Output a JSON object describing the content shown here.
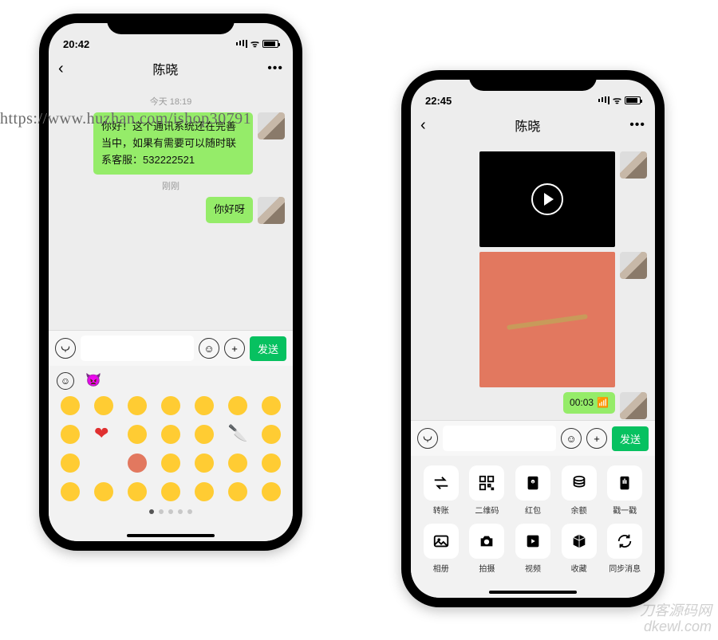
{
  "watermark_url": "https://www.huzhan.com/ishop30791",
  "watermark_corner_line1": "刀客源码网",
  "watermark_corner_line2": "dkewl.com",
  "left": {
    "status_time": "20:42",
    "contact_name": "陈晓",
    "timestamp1": "今天 18:19",
    "msg1": "你好！这个通讯系统还在完善当中，如果有需要可以随时联系客服：532222521",
    "timestamp2": "刚刚",
    "msg2": "你好呀",
    "send_label": "发送"
  },
  "right": {
    "status_time": "22:45",
    "contact_name": "陈晓",
    "audio_duration": "00:03",
    "send_label": "发送",
    "actions_row1": [
      {
        "name": "transfer",
        "label": "转账"
      },
      {
        "name": "qrcode",
        "label": "二维码"
      },
      {
        "name": "redpacket",
        "label": "红包"
      },
      {
        "name": "balance",
        "label": "余额"
      },
      {
        "name": "poke",
        "label": "戳一戳"
      }
    ],
    "actions_row2": [
      {
        "name": "album",
        "label": "相册"
      },
      {
        "name": "camera",
        "label": "拍摄"
      },
      {
        "name": "video",
        "label": "视频"
      },
      {
        "name": "favorite",
        "label": "收藏"
      },
      {
        "name": "sync",
        "label": "同步消息"
      }
    ]
  }
}
